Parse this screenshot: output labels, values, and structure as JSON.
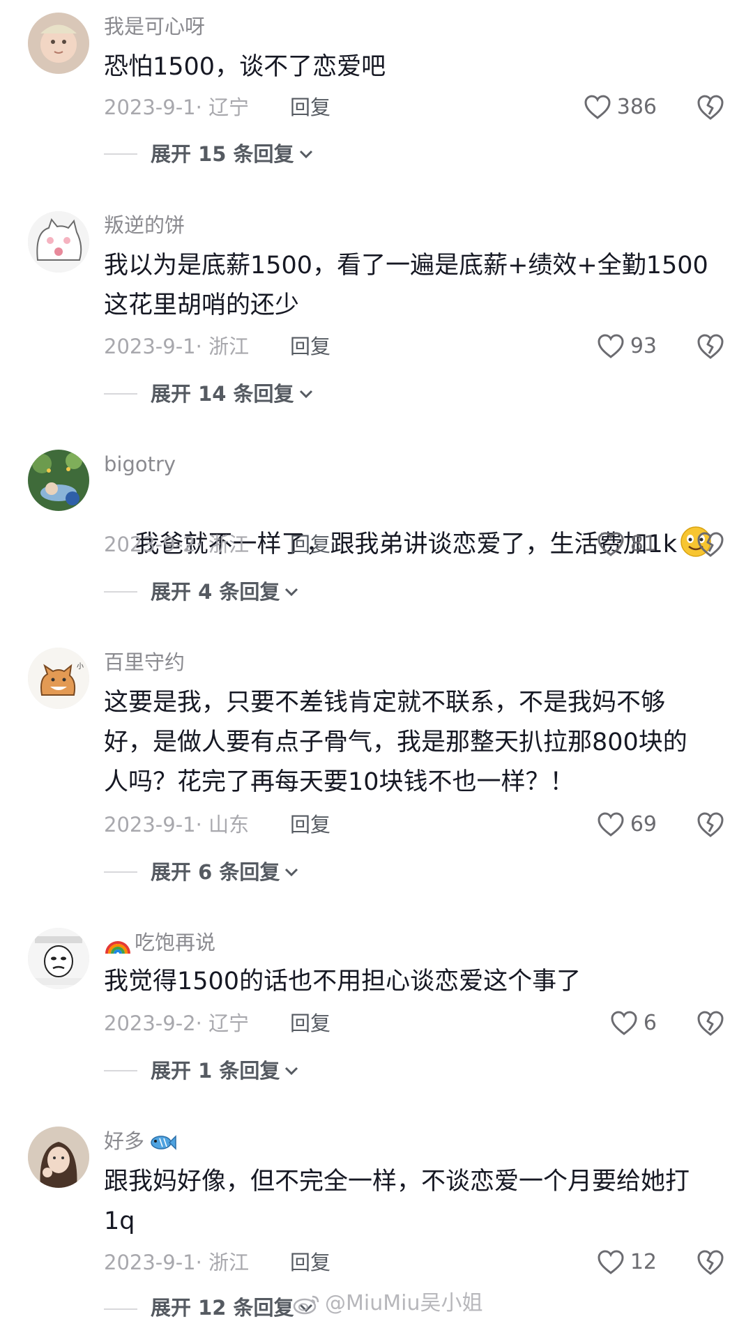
{
  "comments": [
    {
      "username": "我是可心呀",
      "text": "恐怕1500，谈不了恋爱吧",
      "date_location": "2023-9-1· 辽宁",
      "reply_label": "回复",
      "likes": "386",
      "expand_label": "展开 15 条回复"
    },
    {
      "username": "叛逆的饼",
      "text": "我以为是底薪1500，看了一遍是底薪+绩效+全勤1500\n这花里胡哨的还少",
      "date_location": "2023-9-1· 浙江",
      "reply_label": "回复",
      "likes": "93",
      "expand_label": "展开 14 条回复"
    },
    {
      "username": "bigotry",
      "text": "我爸就不一样了，跟我弟讲谈恋爱了，生活费加1k",
      "date_location": "2023-9-2· 浙江",
      "reply_label": "回复",
      "likes": "81",
      "expand_label": "展开 4 条回复"
    },
    {
      "username": "百里守约",
      "text": "这要是我，只要不差钱肯定就不联系，不是我妈不够\n好，是做人要有点子骨气，我是那整天扒拉那800块的\n人吗？花完了再每天要10块钱不也一样？！",
      "date_location": "2023-9-1· 山东",
      "reply_label": "回复",
      "likes": "69",
      "expand_label": "展开 6 条回复"
    },
    {
      "username": "吃饱再说",
      "text": "我觉得1500的话也不用担心谈恋爱这个事了",
      "date_location": "2023-9-2· 辽宁",
      "reply_label": "回复",
      "likes": "6",
      "expand_label": "展开 1 条回复"
    },
    {
      "username": "好多",
      "text": "跟我妈好像，但不完全一样，不谈恋爱一个月要给她打\n1q",
      "date_location": "2023-9-1· 浙江",
      "reply_label": "回复",
      "likes": "12",
      "expand_label": "展开 12 条回复"
    }
  ],
  "watermark": "@MiuMiu吴小姐",
  "colors": {
    "text": "#161823",
    "username": "#8a8a8f",
    "meta": "#a8a8ad",
    "action": "#555a61",
    "background": "#ffffff"
  },
  "icons": {
    "like": "heart-outline-icon",
    "dislike": "broken-heart-icon",
    "expand": "chevron-down-icon",
    "name_emoji_5": "rainbow-emoji",
    "name_emoji_6": "fish-emoji",
    "text_emoji_3": "smile-emoji",
    "watermark": "weibo-logo-icon"
  }
}
